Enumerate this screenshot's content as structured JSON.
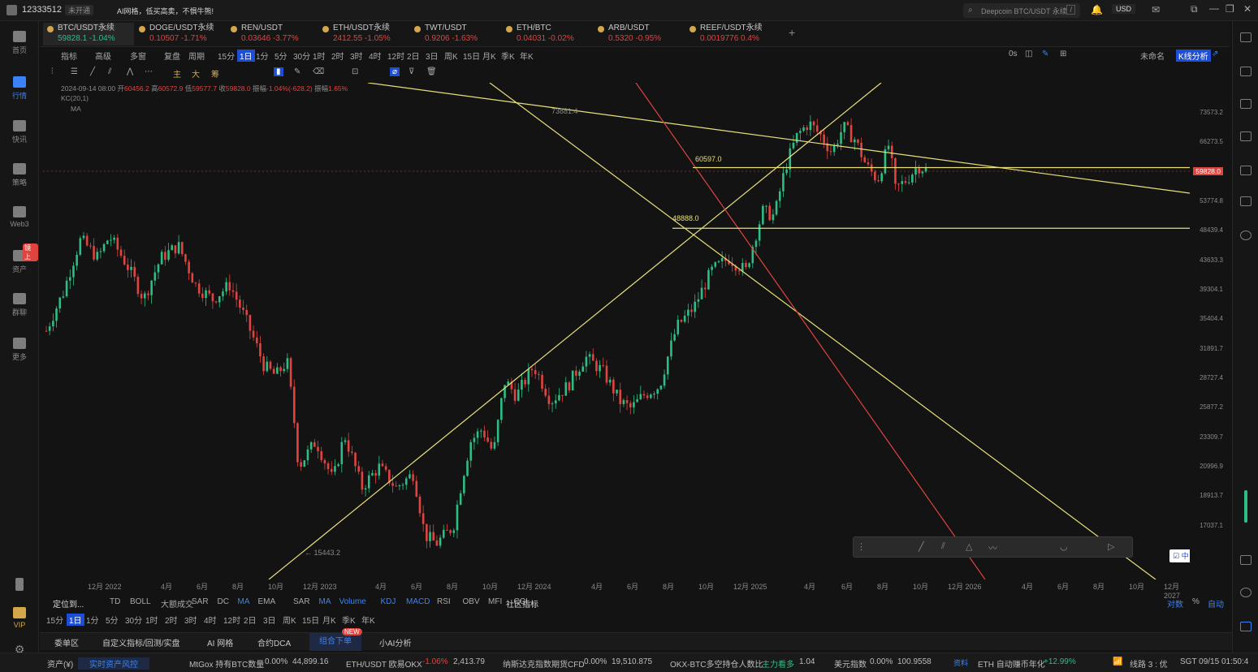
{
  "topbar": {
    "account": "12333512",
    "account_badge": "未开通",
    "promo": "AI网格，低买高卖，不惧牛熊!",
    "search_placeholder": "Deepcoin BTC/USDT 永续",
    "search_shortcut": "/",
    "currency": "USD"
  },
  "nav": [
    {
      "label": "首页"
    },
    {
      "label": "行情"
    },
    {
      "label": "快讯"
    },
    {
      "label": "策略"
    },
    {
      "label": "Web3"
    },
    {
      "label": "资产"
    },
    {
      "label": "群聊"
    },
    {
      "label": "更多"
    },
    {
      "label": "VIP"
    }
  ],
  "nav_badge": "镜上",
  "tickers": [
    {
      "name": "BTC/USDT永续",
      "price": "59828.1",
      "change": "-1.04%"
    },
    {
      "name": "DOGE/USDT永续",
      "price": "0.10507",
      "change": "-1.71%"
    },
    {
      "name": "REN/USDT",
      "price": "0.03646",
      "change": "-3.77%"
    },
    {
      "name": "ETH/USDT永续",
      "price": "2412.55",
      "change": "-1.05%"
    },
    {
      "name": "TWT/USDT",
      "price": "0.9206",
      "change": "-1.63%"
    },
    {
      "name": "ETH/BTC",
      "price": "0.04031",
      "change": "-0.02%"
    },
    {
      "name": "ARB/USDT",
      "price": "0.5320",
      "change": "-0.95%"
    },
    {
      "name": "REEF/USDT永续",
      "price": "0.0019776",
      "change": "0.4%"
    }
  ],
  "toolbar": {
    "indicator": "指标",
    "advanced": "高级",
    "multi": "多窗",
    "replay": "复盘",
    "period": "周期",
    "intervals": [
      "15分",
      "1日",
      "1分",
      "5分",
      "30分",
      "1时",
      "2时",
      "3时",
      "4时",
      "12时",
      "2日",
      "3日",
      "周K",
      "15日",
      "月K",
      "季K",
      "年K"
    ],
    "active_interval": "1日",
    "countdown": "0s",
    "layout_name": "未命名",
    "kline_btn": "K线分析"
  },
  "drawtools": [
    "主",
    "大",
    "筹"
  ],
  "ohlc": {
    "date": "2024-09-14 08:00",
    "open_label": "开",
    "open": "60456.2",
    "high_label": "高",
    "high": "60572.9",
    "low_label": "低",
    "low": "59577.7",
    "close_label": "收",
    "close": "59828.0",
    "chg_label": "振幅",
    "chg": "-1.04%(-628.2)",
    "amp_label": "振幅",
    "amp": "1.65%",
    "kc": "KC(20,1)",
    "ma": "MA"
  },
  "chart_data": {
    "type": "candlestick",
    "symbol": "BTC/USDT永续",
    "interval": "1日",
    "annotations": {
      "high": "73881.4",
      "low": "15443.2",
      "level_top": "60597.0",
      "level_bottom": "48888.0",
      "last_price": "59828.0"
    },
    "y_ticks": [
      "73573.2",
      "66273.5",
      "59828.0",
      "53774.8",
      "48439.4",
      "43633.3",
      "39304.1",
      "35404.4",
      "31891.7",
      "28727.4",
      "25877.2",
      "23309.7",
      "20996.9",
      "18913.7",
      "17037.1"
    ],
    "x_ticks": [
      "12月 2022",
      "4月",
      "6月",
      "8月",
      "10月",
      "12月 2023",
      "4月",
      "6月",
      "8月",
      "10月",
      "12月 2024",
      "4月",
      "6月",
      "8月",
      "10月",
      "12月 2025",
      "4月",
      "6月",
      "8月",
      "10月",
      "12月 2026",
      "4月",
      "6月",
      "8月",
      "10月",
      "12月 2027"
    ],
    "price_path": [
      [
        0,
        34000
      ],
      [
        0.015,
        39000
      ],
      [
        0.03,
        47000
      ],
      [
        0.045,
        44000
      ],
      [
        0.055,
        47500
      ],
      [
        0.07,
        43000
      ],
      [
        0.085,
        38000
      ],
      [
        0.1,
        44000
      ],
      [
        0.115,
        46000
      ],
      [
        0.13,
        40000
      ],
      [
        0.145,
        38000
      ],
      [
        0.16,
        40000
      ],
      [
        0.175,
        35000
      ],
      [
        0.19,
        30000
      ],
      [
        0.2,
        29000
      ],
      [
        0.21,
        30500
      ],
      [
        0.22,
        21000
      ],
      [
        0.235,
        23000
      ],
      [
        0.25,
        20000
      ],
      [
        0.26,
        23500
      ],
      [
        0.275,
        19500
      ],
      [
        0.29,
        21000
      ],
      [
        0.305,
        19500
      ],
      [
        0.32,
        20500
      ],
      [
        0.33,
        16500
      ],
      [
        0.34,
        16000
      ],
      [
        0.355,
        17000
      ],
      [
        0.37,
        23000
      ],
      [
        0.38,
        24000
      ],
      [
        0.39,
        22000
      ],
      [
        0.4,
        28500
      ],
      [
        0.41,
        27000
      ],
      [
        0.425,
        30000
      ],
      [
        0.44,
        26500
      ],
      [
        0.455,
        28000
      ],
      [
        0.47,
        31000
      ],
      [
        0.485,
        29500
      ],
      [
        0.5,
        26500
      ],
      [
        0.51,
        25800
      ],
      [
        0.52,
        27000
      ],
      [
        0.535,
        28000
      ],
      [
        0.55,
        34500
      ],
      [
        0.565,
        37000
      ],
      [
        0.58,
        42000
      ],
      [
        0.595,
        44000
      ],
      [
        0.61,
        42000
      ],
      [
        0.625,
        52000
      ],
      [
        0.635,
        51000
      ],
      [
        0.645,
        61000
      ],
      [
        0.655,
        68000
      ],
      [
        0.665,
        71000
      ],
      [
        0.675,
        68000
      ],
      [
        0.685,
        64000
      ],
      [
        0.695,
        70000
      ],
      [
        0.705,
        67000
      ],
      [
        0.715,
        61000
      ],
      [
        0.725,
        58000
      ],
      [
        0.735,
        66000
      ],
      [
        0.74,
        56000
      ],
      [
        0.75,
        58000
      ],
      [
        0.76,
        61000
      ],
      [
        0.77,
        59828
      ]
    ]
  },
  "indicators": {
    "locate": "定位到...",
    "list": [
      "TD",
      "BOLL",
      "大额成交",
      "SAR",
      "DC",
      "MA",
      "EMA",
      "SAR",
      "MA",
      "Volume",
      "KDJ",
      "MACD",
      "RSI",
      "OBV",
      "MFI",
      "CCI"
    ],
    "community": "社区指标",
    "right": [
      "对数",
      "%",
      "自动"
    ]
  },
  "bottom_tabs": [
    "委单区",
    "自定义指标/回测/实盘",
    "AI 网格",
    "合约DCA",
    "组合下单",
    "小AI分析"
  ],
  "bottom_new": "NEW",
  "status": [
    {
      "label": "资产(¥)"
    },
    {
      "label": "实时资产风控"
    },
    {
      "label": "MtGox 持有BTC数量",
      "chg": "0.00%",
      "val": "44,899.16"
    },
    {
      "label": "ETH/USDT 欧易OKX",
      "chg": "-1.06%",
      "val": "2,413.79"
    },
    {
      "label": "纳斯达克指数期货CFD",
      "chg": "0.00%",
      "val": "19,510.875"
    },
    {
      "label": "OKX-BTC多空持仓人数比",
      "chg": "主力看多",
      "val": "1.04"
    },
    {
      "label": "美元指数",
      "chg": "0.00%",
      "val": "100.9558"
    },
    {
      "label": "资料"
    },
    {
      "label": "ETH 自动赚币年化",
      "chg": "+12.99%"
    },
    {
      "label": "线路 3 : 优"
    },
    {
      "label": "SGT 09/15 01:50:4"
    }
  ],
  "colors": {
    "up": "#2ebd85",
    "down": "#e0443f",
    "trend": "#e8e07a",
    "accent": "#3b82f6"
  }
}
